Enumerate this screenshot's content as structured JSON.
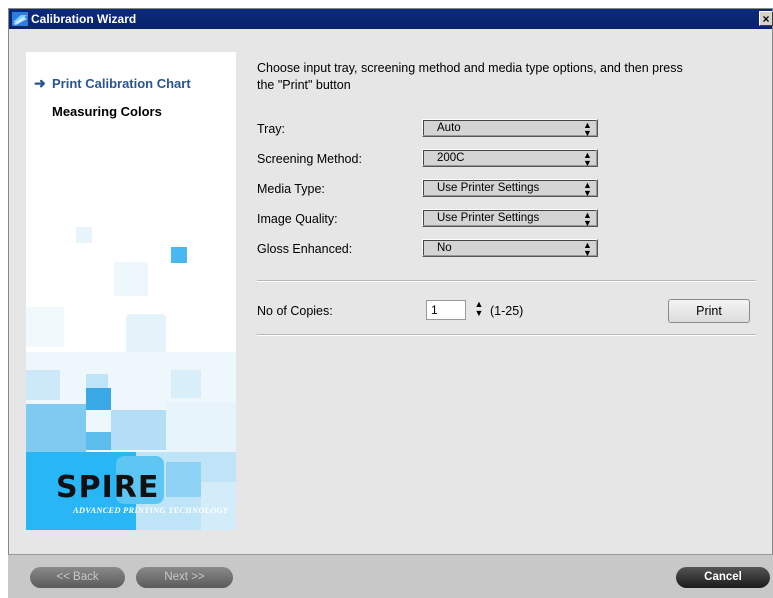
{
  "window": {
    "title": "Calibration Wizard",
    "close_label": "×"
  },
  "steps": [
    {
      "label": "Print Calibration Chart",
      "current": true
    },
    {
      "label": "Measuring Colors",
      "current": false
    }
  ],
  "brand": {
    "logo_text": "SPIRE",
    "tagline": "ADVANCED PRINTING TECHNOLOGY"
  },
  "intro": "Choose input tray, screening method and media type options, and then press the \"Print\" button",
  "fields": [
    {
      "label": "Tray:",
      "value": "Auto"
    },
    {
      "label": "Screening Method:",
      "value": "200C"
    },
    {
      "label": "Media Type:",
      "value": "Use Printer Settings"
    },
    {
      "label": "Image Quality:",
      "value": "Use Printer Settings"
    },
    {
      "label": "Gloss Enhanced:",
      "value": "No"
    }
  ],
  "copies": {
    "label": "No of Copies:",
    "value": "1",
    "range": "(1-25)"
  },
  "print_label": "Print",
  "buttons": {
    "back": "<< Back",
    "next": "Next >>",
    "cancel": "Cancel"
  },
  "colors": {
    "titlebar": "#08246b",
    "accent": "#29558f",
    "brand_blue": "#29b6f6"
  }
}
